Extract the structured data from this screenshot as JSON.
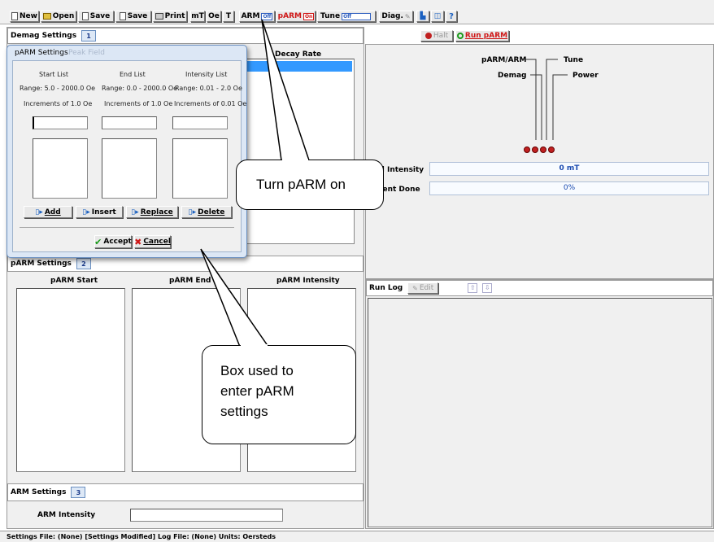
{
  "toolbar": {
    "new": "New",
    "open": "Open",
    "save_as": "Save",
    "save": "Save",
    "print": "Print",
    "mt": "mT",
    "oe": "Oe",
    "t": "T",
    "arm": "ARM",
    "arm_state": "Off",
    "parm": "pARM",
    "parm_state": "On",
    "tune": "Tune",
    "tune_state": "Off",
    "diag": "Diag."
  },
  "demag_panel": {
    "title": "Demag Settings",
    "tab_num": "1",
    "col_decay_rate": "Decay Rate"
  },
  "parm_dialog": {
    "title": "pARM Settings",
    "subtitle": "Peak Field",
    "columns": [
      {
        "header": "Start List",
        "range": "Range: 5.0 - 2000.0 Oe",
        "increment": "Increments of 1.0 Oe"
      },
      {
        "header": "End List",
        "range": "Range: 0.0 - 2000.0 Oe",
        "increment": "Increments of 1.0 Oe"
      },
      {
        "header": "Intensity List",
        "range": "Range: 0.01 - 2.0 Oe",
        "increment": "Increments of 0.01 Oe"
      }
    ],
    "buttons": {
      "add": "Add",
      "insert": "Insert",
      "replace": "Replace",
      "delete": "Delete",
      "accept": "Accept",
      "cancel": "Cancel"
    }
  },
  "parm_panel": {
    "title": "pARM Settings",
    "tab_num": "2",
    "cols": [
      "pARM Start",
      "pARM End",
      "pARM Intensity"
    ]
  },
  "arm_panel": {
    "title": "ARM Settings",
    "tab_num": "3",
    "intensity_label": "ARM Intensity",
    "intensity_value": ""
  },
  "control": {
    "halt": "Halt",
    "run": "Run pARM",
    "lights": [
      "pARM/ARM",
      "Demag",
      "Tune",
      "Power"
    ],
    "field_intensity_label": "Field Intensity",
    "field_intensity_value": "0 mT",
    "percent_done_label": "Percent Done",
    "percent_done_value": "0%"
  },
  "runlog": {
    "title": "Run Log",
    "edit": "Edit"
  },
  "status_bar": "Settings File: (None)   [Settings Modified]   Log File: (None)   Units: Oersteds",
  "callouts": {
    "turn_on": "Turn pARM on",
    "box_lines": [
      "Box used to",
      "enter pARM",
      "settings"
    ]
  },
  "colors": {
    "accent_red": "#d01818",
    "run_green": "#1a9a1a",
    "panel_bg": "#f0f0f0",
    "dialog_border": "#6a8fc0"
  }
}
